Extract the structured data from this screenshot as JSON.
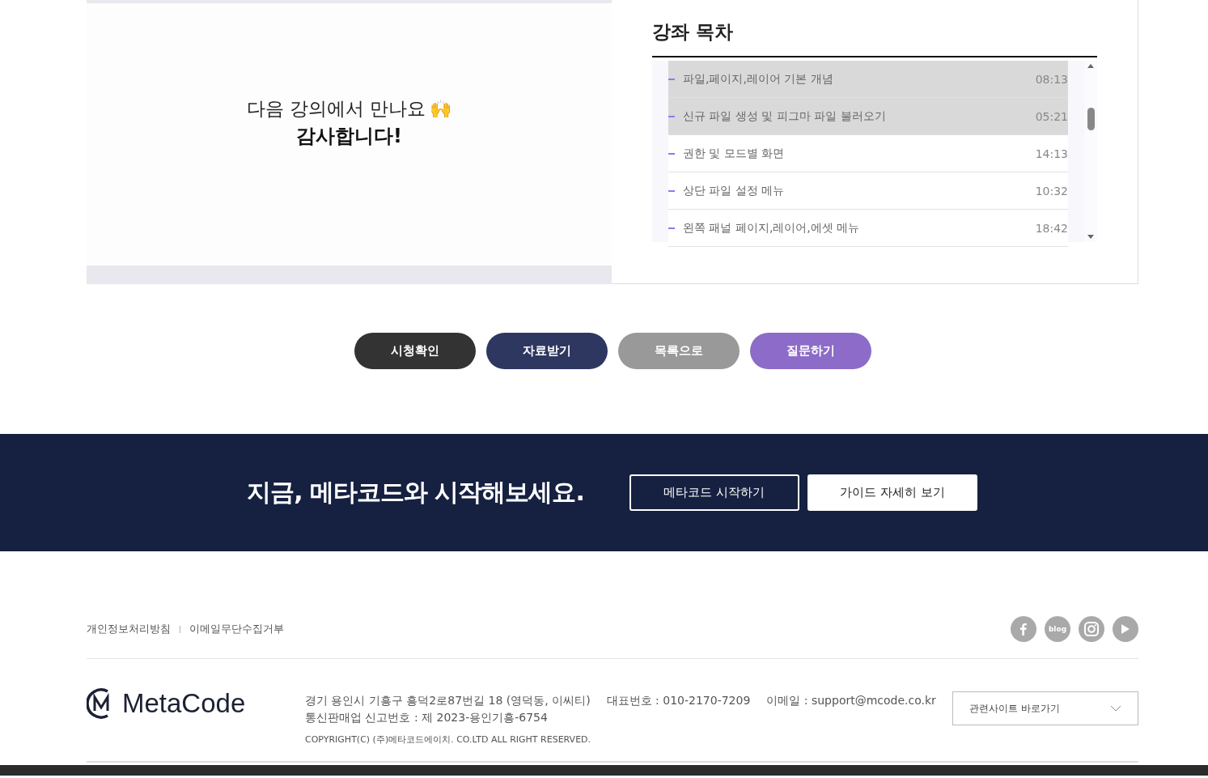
{
  "video": {
    "message": "다음 강의에서 만나요",
    "emoji": "🙌",
    "thanks": "감사합니다!"
  },
  "curriculum": {
    "title": "강좌 목차",
    "items": [
      {
        "title": "파일,페이지,레이어 기본 개념",
        "duration": "08:13",
        "selected": true
      },
      {
        "title": "신규 파일 생성 및 피그마 파일 불러오기",
        "duration": "05:21",
        "selected": true
      },
      {
        "title": "권한 및 모드별 화면",
        "duration": "14:13",
        "selected": false
      },
      {
        "title": "상단 파일 설정 메뉴",
        "duration": "10:32",
        "selected": false
      },
      {
        "title": "왼쪽 패널 페이지,레이어,에셋 메뉴",
        "duration": "18:42",
        "selected": false
      }
    ]
  },
  "actions": [
    {
      "label": "시청확인",
      "color": "#333333"
    },
    {
      "label": "자료받기",
      "color": "#2e3760"
    },
    {
      "label": "목록으로",
      "color": "#999999"
    },
    {
      "label": "질문하기",
      "color": "#8c6cc8"
    }
  ],
  "banner": {
    "headline": "지금, 메타코드와 시작해보세요.",
    "buttons": [
      {
        "label": "메타코드 시작하기",
        "kind": "outline"
      },
      {
        "label": "가이드 자세히 보기",
        "kind": "solid"
      }
    ]
  },
  "footer": {
    "links": [
      "개인정보처리방침",
      "이메일무단수집거부"
    ],
    "separator": "|",
    "social": [
      {
        "kind": "facebook"
      },
      {
        "kind": "blog",
        "label": "blog"
      },
      {
        "kind": "instagram"
      },
      {
        "kind": "youtube"
      }
    ],
    "logo": "MetaCode",
    "info_lines": [
      [
        "경기 용인시 기흥구 흥덕2로87번길 18 (영덕동, 이씨티)",
        "대표번호 : 010-2170-7209",
        "이메일 : support@mcode.co.kr"
      ],
      [
        "통신판매업 신고번호 : 제 2023-용인기흥-6754"
      ]
    ],
    "copyright": "COPYRIGHT(C) (주)메타코드에이치. CO.LTD ALL RIGHT RESERVED.",
    "site_select": {
      "placeholder": "관련사이트 바로가기"
    }
  }
}
